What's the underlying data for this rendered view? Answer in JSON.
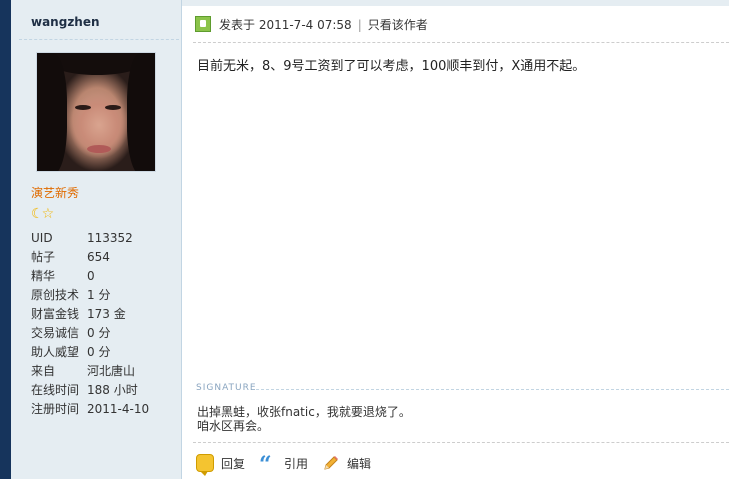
{
  "author": {
    "username": "wangzhen",
    "rank": "演艺新秀",
    "stars": [
      "moon",
      "star"
    ],
    "stats": [
      {
        "key": "UID",
        "value": "113352"
      },
      {
        "key": "帖子",
        "value": "654"
      },
      {
        "key": "精华",
        "value": "0"
      },
      {
        "key": "原创技术",
        "value": "1 分"
      },
      {
        "key": "财富金钱",
        "value": "173 金"
      },
      {
        "key": "交易诚信",
        "value": "0 分"
      },
      {
        "key": "助人威望",
        "value": "0 分"
      },
      {
        "key": "来自",
        "value": "河北唐山"
      },
      {
        "key": "在线时间",
        "value": "188 小时"
      },
      {
        "key": "注册时间",
        "value": "2011-4-10"
      }
    ]
  },
  "post": {
    "posted_label": "发表于 2011-7-4 07:58",
    "separator": "|",
    "only_author_label": "只看该作者",
    "content": "目前无米，8、9号工资到了可以考虑，100顺丰到付，X通用不起。"
  },
  "signature": {
    "label": "SIGNATURE",
    "line1": "出掉黑蛙，收张fnatic，我就要退烧了。",
    "line2": "咱水区再会。"
  },
  "actions": {
    "reply": "回复",
    "quote": "引用",
    "edit": "编辑"
  },
  "colors": {
    "sidebar_bg": "#e5edf2",
    "left_edge": "#16345c",
    "rank": "#e06b00"
  }
}
